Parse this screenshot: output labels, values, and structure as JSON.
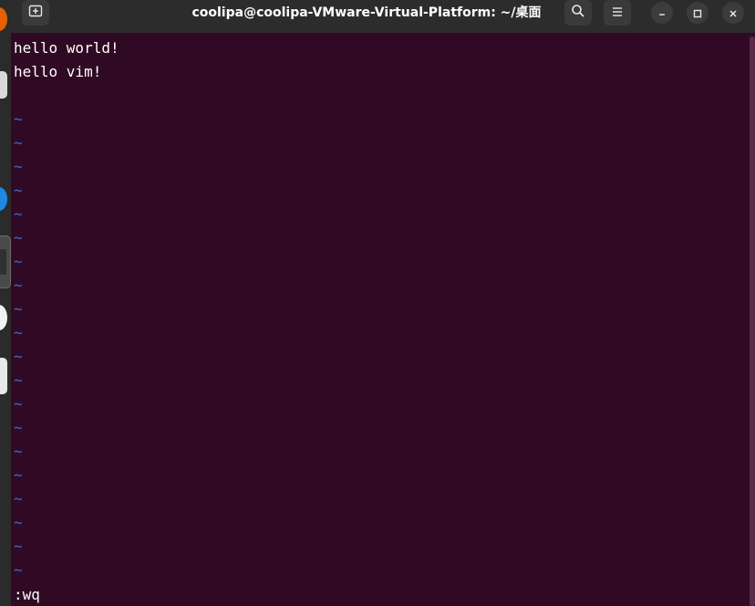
{
  "window": {
    "title": "coolipa@coolipa-VMware-Virtual-Platform: ~/桌面"
  },
  "headerbar": {
    "new_tab_icon": "new-tab-icon",
    "search_icon": "search-icon",
    "menu_icon": "hamburger-menu-icon",
    "minimize_icon": "minimize-icon",
    "maximize_icon": "maximize-icon",
    "close_icon": "close-icon"
  },
  "editor": {
    "lines": [
      "hello world!",
      "hello vim!",
      ""
    ],
    "empty_line_marker": "~",
    "empty_line_count": 20,
    "command_line": ":wq"
  },
  "colors": {
    "terminal_background": "#300a24",
    "headerbar_background": "#2c2c2c",
    "text": "#ffffff",
    "tilde": "#3f6cc6"
  }
}
